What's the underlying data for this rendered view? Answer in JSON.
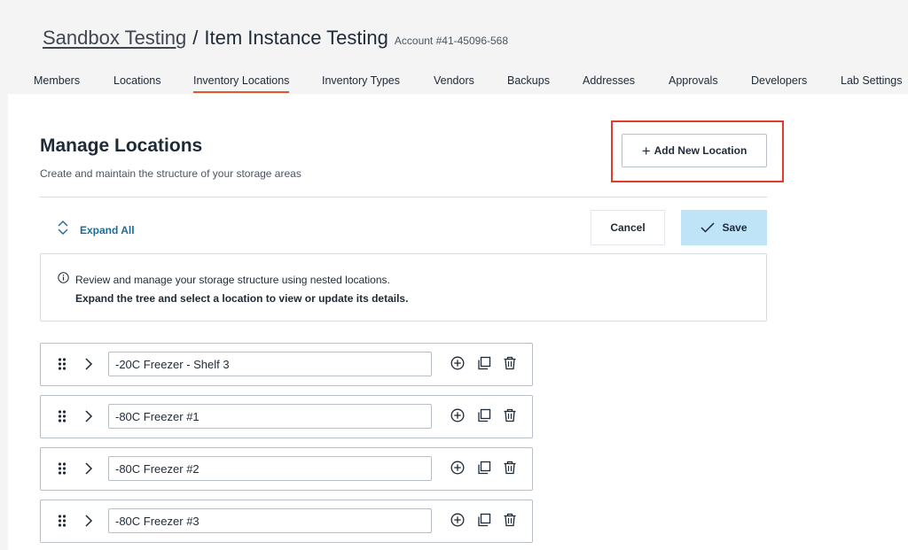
{
  "breadcrumb": {
    "parent": "Sandbox Testing",
    "separator": "/",
    "current": "Item Instance Testing",
    "account": "Account #41-45096-568"
  },
  "tabs": [
    {
      "label": "Members"
    },
    {
      "label": "Locations"
    },
    {
      "label": "Inventory Locations",
      "active": true
    },
    {
      "label": "Inventory Types"
    },
    {
      "label": "Vendors"
    },
    {
      "label": "Backups"
    },
    {
      "label": "Addresses"
    },
    {
      "label": "Approvals"
    },
    {
      "label": "Developers"
    },
    {
      "label": "Lab Settings"
    }
  ],
  "page": {
    "title": "Manage Locations",
    "subtitle": "Create and maintain the structure of your storage areas"
  },
  "actions": {
    "add_new_location": "Add New Location",
    "expand_all": "Expand All",
    "cancel": "Cancel",
    "save": "Save"
  },
  "info": {
    "line1": "Review and manage your storage structure using nested locations.",
    "line2": "Expand the tree and select a location to view or update its details."
  },
  "locations": [
    {
      "name": "-20C Freezer - Shelf 3"
    },
    {
      "name": "-80C Freezer #1"
    },
    {
      "name": "-80C Freezer #2"
    },
    {
      "name": "-80C Freezer #3"
    }
  ],
  "colors": {
    "accent_tab_underline": "#e4572e",
    "highlight_box": "#e53b2c",
    "link": "#1e6c96",
    "save_button_bg": "#bfe3f7"
  },
  "icons": {
    "expand": "expand-collapse-icon",
    "info": "info-icon",
    "drag": "drag-handle-icon",
    "chevron": "chevron-right-icon",
    "add_child": "add-circle-icon",
    "duplicate": "duplicate-icon",
    "delete": "trash-icon"
  }
}
